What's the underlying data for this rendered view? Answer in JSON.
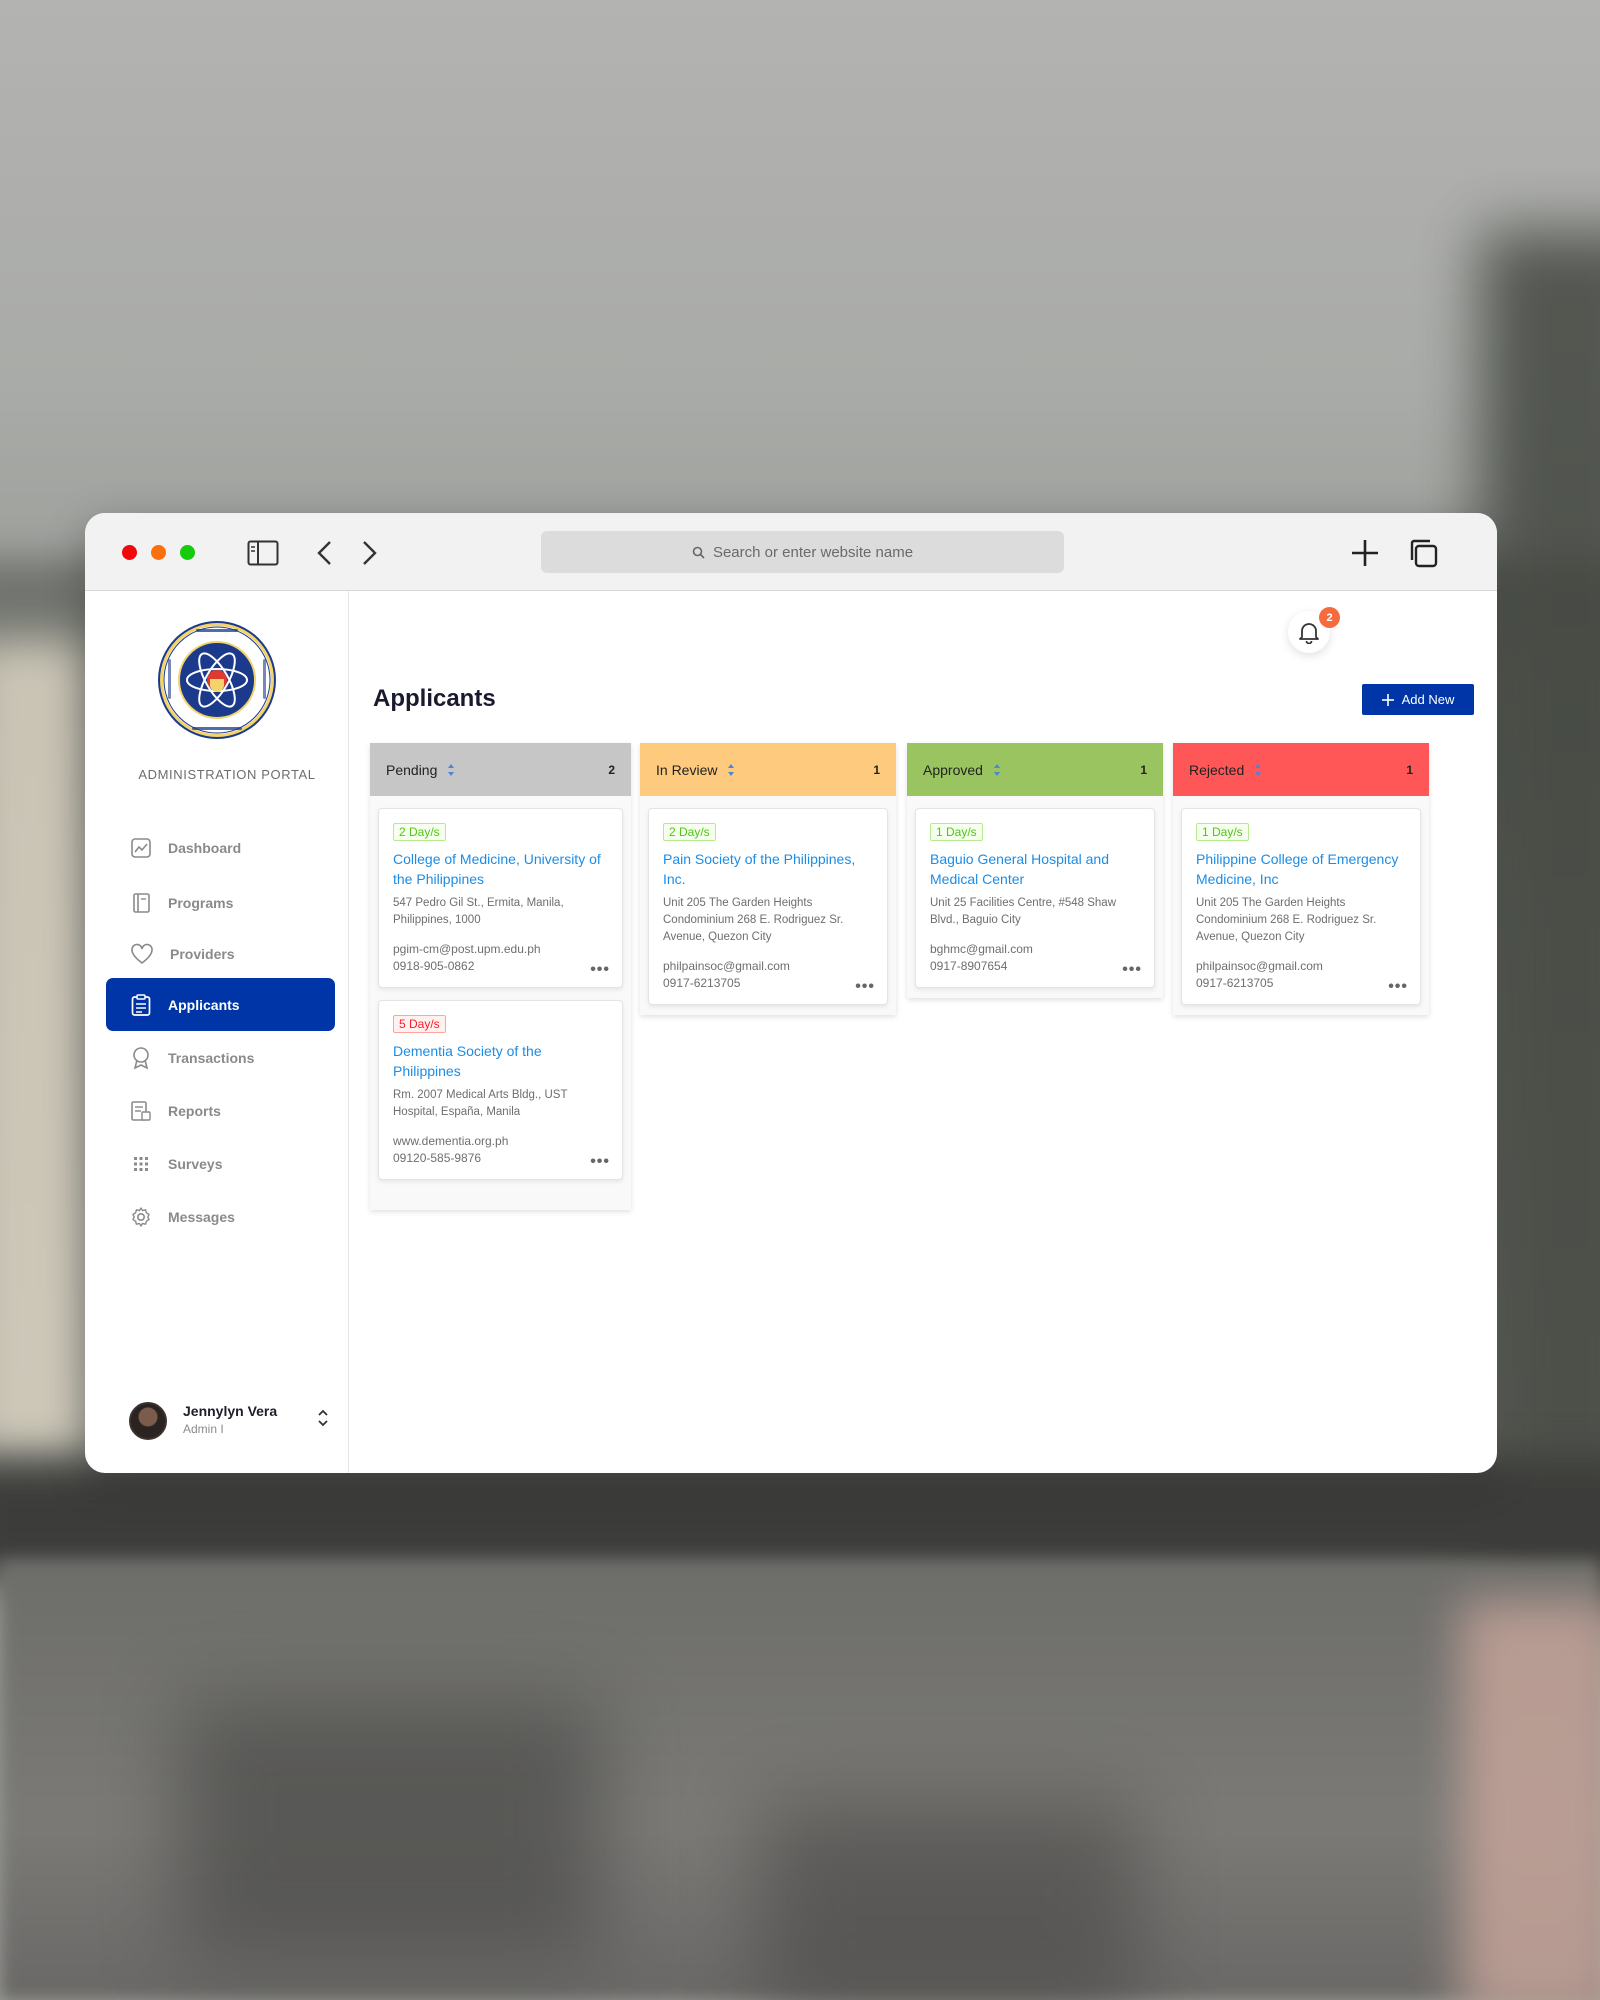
{
  "browser": {
    "search_placeholder": "Search or enter website name"
  },
  "sidebar": {
    "portal_label": "ADMINISTRATION PORTAL",
    "items": [
      {
        "label": "Dashboard",
        "icon": "chart-icon"
      },
      {
        "label": "Programs",
        "icon": "book-icon"
      },
      {
        "label": "Providers",
        "icon": "heart-icon"
      },
      {
        "label": "Applicants",
        "icon": "clipboard-icon",
        "active": true
      },
      {
        "label": "Transactions",
        "icon": "award-icon"
      },
      {
        "label": "Reports",
        "icon": "report-icon"
      },
      {
        "label": "Surveys",
        "icon": "grid-icon"
      },
      {
        "label": "Messages",
        "icon": "gear-icon"
      }
    ],
    "user": {
      "name": "Jennylyn Vera",
      "role": "Admin I"
    }
  },
  "header": {
    "notification_count": "2",
    "page_title": "Applicants",
    "add_button_label": "Add New"
  },
  "colors": {
    "primary": "#0035a8",
    "pending": "#c6c6c6",
    "in_review": "#fecb7e",
    "approved": "#99c45f",
    "rejected": "#ff5757",
    "link": "#1d8ce4",
    "badge": "#f56a3e"
  },
  "columns": [
    {
      "title": "Pending",
      "count": "2",
      "cards": [
        {
          "days": "2 Day/s",
          "title": "College of Medicine, University of the Philippines",
          "address": "547 Pedro Gil St., Ermita, Manila, Philippines, 1000",
          "email": "pgim-cm@post.upm.edu.ph",
          "phone": "0918-905-0862"
        },
        {
          "days": "5 Day/s",
          "title": "Dementia Society of the Philippines",
          "address": "Rm. 2007 Medical Arts Bldg., UST Hospital, España, Manila",
          "email": "www.dementia.org.ph",
          "phone": "09120-585-9876"
        }
      ]
    },
    {
      "title": "In Review",
      "count": "1",
      "cards": [
        {
          "days": "2 Day/s",
          "title": "Pain Society of the Philippines, Inc.",
          "address": "Unit 205 The Garden Heights Condominium 268 E. Rodriguez Sr. Avenue, Quezon City",
          "email": "philpainsoc@gmail.com",
          "phone": "0917-6213705"
        }
      ]
    },
    {
      "title": "Approved",
      "count": "1",
      "cards": [
        {
          "days": "1 Day/s",
          "title": "Baguio General Hospital and Medical Center",
          "address": "Unit 25 Facilities Centre, #548 Shaw Blvd., Baguio City",
          "email": "bghmc@gmail.com",
          "phone": "0917-8907654"
        }
      ]
    },
    {
      "title": "Rejected",
      "count": "1",
      "cards": [
        {
          "days": "1 Day/s",
          "title": "Philippine College of Emergency Medicine, Inc",
          "address": "Unit 205 The Garden Heights Condominium 268 E. Rodriguez Sr. Avenue, Quezon City",
          "email": "philpainsoc@gmail.com",
          "phone": "0917-6213705"
        }
      ]
    }
  ]
}
